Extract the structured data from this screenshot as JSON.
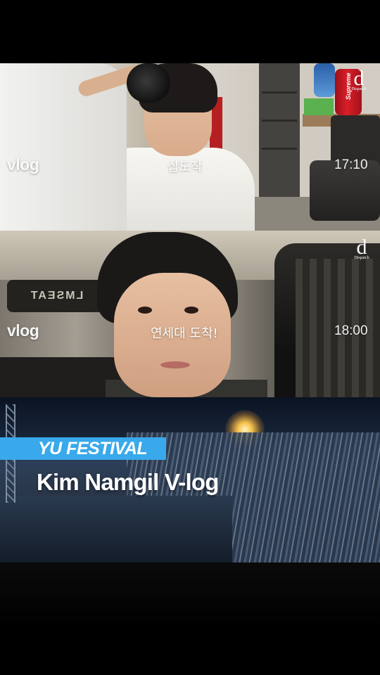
{
  "clips": [
    {
      "vlog_label": "vlog",
      "caption": "샵도착",
      "time": "17:10"
    },
    {
      "vlog_label": "vlog",
      "caption": "연세대 도착!",
      "time": "18:00"
    }
  ],
  "watermark": {
    "letter": "d",
    "sub": "Dispatch"
  },
  "can_label": "Supreme",
  "seat_text": "LMSEAT",
  "tag": {
    "label": "YU FESTIVAL",
    "color": "#39a9eb"
  },
  "title": "Kim Namgil V-log"
}
